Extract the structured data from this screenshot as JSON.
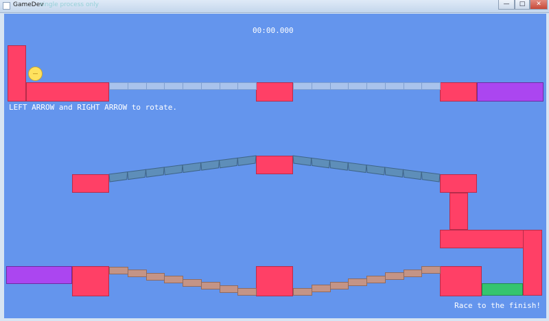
{
  "window": {
    "title": "GameDev",
    "ghost_title": "single process only",
    "minimize_label": "—",
    "maximize_label": "□",
    "close_label": "✕"
  },
  "hud": {
    "timer": "00:00.000",
    "hint_left": "LEFT ARROW and RIGHT ARROW to rotate.",
    "hint_right": "Race to the finish!"
  },
  "colors": {
    "sky": "#6495ed",
    "platform": "#ff4066",
    "portal": "#ab46f0",
    "finish": "#35c46f",
    "ball": "#ffe15e",
    "bridge_top": "#a9c3ec",
    "bridge_middle": "#5e8eb9",
    "bridge_bottom": "#c49486"
  },
  "icons": {
    "app": "app-window-icon",
    "minimize": "minimize-icon",
    "maximize": "maximize-icon",
    "close": "close-icon"
  }
}
